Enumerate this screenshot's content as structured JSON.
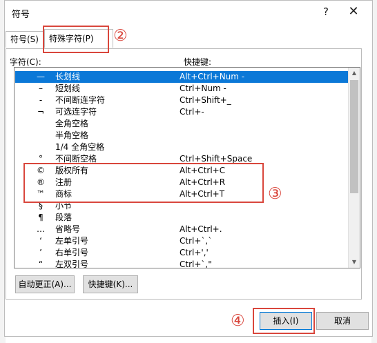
{
  "window": {
    "title": "符号",
    "help_glyph": "?",
    "close_glyph": "✕"
  },
  "tabs": [
    {
      "label": "符号(S)",
      "active": false
    },
    {
      "label": "特殊字符(P)",
      "active": true
    }
  ],
  "list_headers": {
    "character": "字符(C):",
    "shortcut": "快捷键:"
  },
  "characters": [
    {
      "symbol": "—",
      "name": "长划线",
      "shortcut": "Alt+Ctrl+Num -",
      "selected": true
    },
    {
      "symbol": "–",
      "name": "短划线",
      "shortcut": "Ctrl+Num -"
    },
    {
      "symbol": "-",
      "name": "不间断连字符",
      "shortcut": "Ctrl+Shift+_"
    },
    {
      "symbol": "¬",
      "name": "可选连字符",
      "shortcut": "Ctrl+-"
    },
    {
      "symbol": "",
      "name": "全角空格",
      "shortcut": ""
    },
    {
      "symbol": "",
      "name": "半角空格",
      "shortcut": ""
    },
    {
      "symbol": "",
      "name": "1/4 全角空格",
      "shortcut": ""
    },
    {
      "symbol": "°",
      "name": "不间断空格",
      "shortcut": "Ctrl+Shift+Space"
    },
    {
      "symbol": "©",
      "name": "版权所有",
      "shortcut": "Alt+Ctrl+C"
    },
    {
      "symbol": "®",
      "name": "注册",
      "shortcut": "Alt+Ctrl+R"
    },
    {
      "symbol": "™",
      "name": "商标",
      "shortcut": "Alt+Ctrl+T"
    },
    {
      "symbol": "§",
      "name": "小节",
      "shortcut": ""
    },
    {
      "symbol": "¶",
      "name": "段落",
      "shortcut": ""
    },
    {
      "symbol": "…",
      "name": "省略号",
      "shortcut": "Alt+Ctrl+."
    },
    {
      "symbol": "‘",
      "name": "左单引号",
      "shortcut": "Ctrl+`,`"
    },
    {
      "symbol": "’",
      "name": "右单引号",
      "shortcut": "Ctrl+','"
    },
    {
      "symbol": "“",
      "name": "左双引号",
      "shortcut": "Ctrl+`,\""
    }
  ],
  "buttons": {
    "autocorrect": "自动更正(A)...",
    "shortcut_key": "快捷键(K)...",
    "insert": "插入(I)",
    "cancel": "取消"
  },
  "annotations": {
    "callout_2": "②",
    "callout_3": "③",
    "callout_4": "④",
    "accent_color": "#d9463c"
  },
  "scrollbar": {
    "up_glyph": "▲",
    "down_glyph": "▼"
  }
}
